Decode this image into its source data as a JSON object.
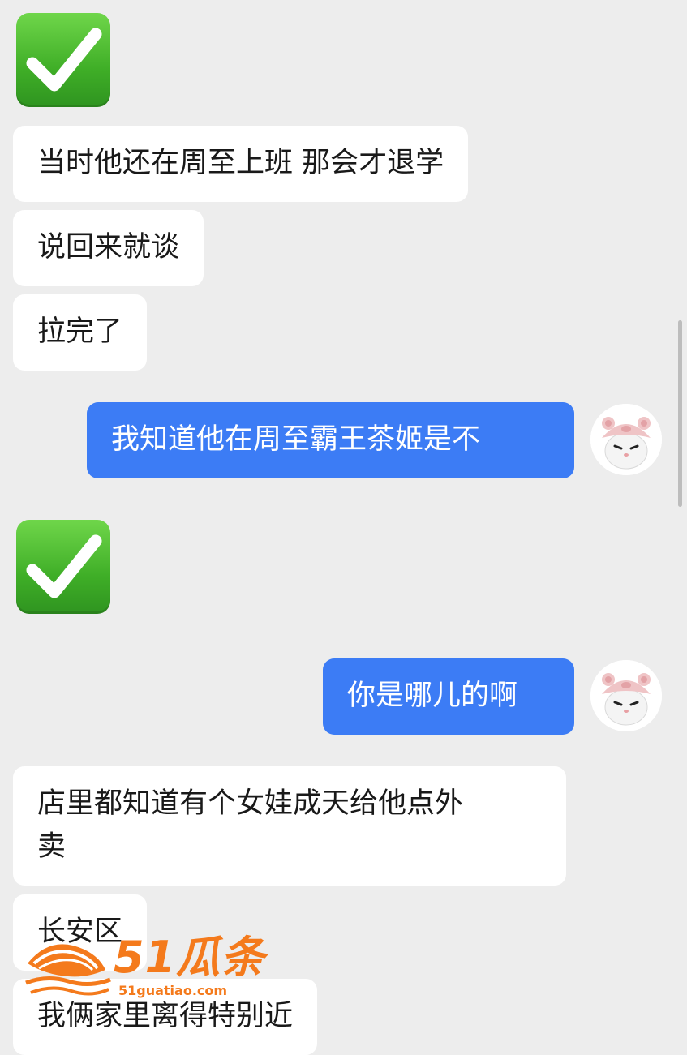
{
  "messages": [
    {
      "id": "m1",
      "side": "left",
      "type": "emoji",
      "emoji": "white-heavy-check-mark"
    },
    {
      "id": "m2",
      "side": "left",
      "type": "text",
      "text": "当时他还在周至上班 那会才退学"
    },
    {
      "id": "m3",
      "side": "left",
      "type": "text",
      "text": "说回来就谈"
    },
    {
      "id": "m4",
      "side": "left",
      "type": "text",
      "text": "拉完了"
    },
    {
      "id": "m5",
      "side": "right",
      "type": "text",
      "text": "我知道他在周至霸王茶姬是不"
    },
    {
      "id": "m6",
      "side": "left",
      "type": "emoji",
      "emoji": "white-heavy-check-mark"
    },
    {
      "id": "m7",
      "side": "right",
      "type": "text",
      "text": "你是哪儿的啊"
    },
    {
      "id": "m8",
      "side": "left",
      "type": "text",
      "text": "店里都知道有个女娃成天给他点外\n卖"
    },
    {
      "id": "m9",
      "side": "left",
      "type": "text",
      "text": "长安区"
    },
    {
      "id": "m10",
      "side": "left",
      "type": "text",
      "text": "我俩家里离得特别近"
    }
  ],
  "watermark": {
    "brand": "51瓜条",
    "url": "51guatiao.com"
  },
  "colors": {
    "background": "#ededed",
    "incoming_bubble": "#ffffff",
    "outgoing_bubble": "#3c7cf5",
    "check_green": "#43b02a",
    "watermark_orange": "#f47a1c"
  },
  "icons": {
    "avatar": "pink-bear-hat-cat-avatar",
    "emoji": "white-heavy-check-mark"
  }
}
